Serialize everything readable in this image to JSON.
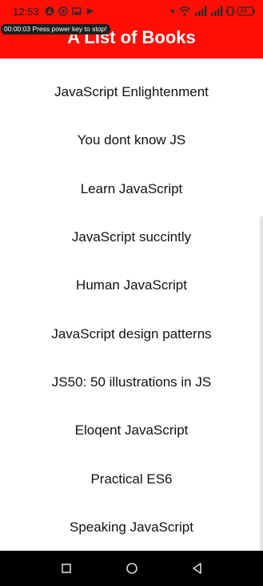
{
  "status_bar": {
    "time": "12:53",
    "battery_level": "44"
  },
  "recording_notice": "00:00:03  Press power key to stop!",
  "header": {
    "title": "A List of Books",
    "background_color": "#fd0f07"
  },
  "books": [
    "JavaScript Enlightenment",
    "You dont know JS",
    "Learn JavaScript",
    "JavaScript succintly",
    "Human JavaScript",
    "JavaScript design patterns",
    "JS50: 50 illustrations in JS",
    "Eloqent JavaScript",
    "Practical ES6",
    "Speaking JavaScript"
  ],
  "nav_bar": {
    "recent_icon": "square-recent-apps-icon",
    "home_icon": "circle-home-icon",
    "back_icon": "triangle-back-icon"
  }
}
